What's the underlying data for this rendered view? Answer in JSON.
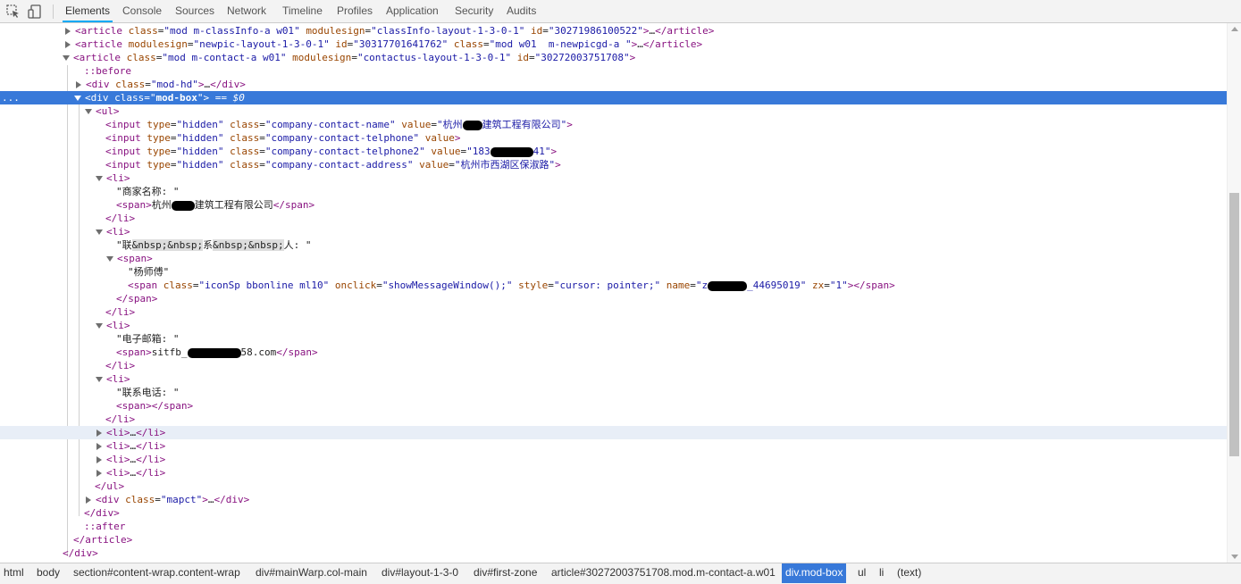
{
  "toolbar": {
    "tabs": [
      "Elements",
      "Console",
      "Sources",
      "Network",
      "Timeline",
      "Profiles",
      "Application",
      "Security",
      "Audits"
    ],
    "active_tab": "Elements",
    "icons": [
      "inspect-icon",
      "device-mode-icon"
    ]
  },
  "tree": {
    "lines": [
      {
        "a1": "article",
        "a1c": "mod m-classInfo-a w01",
        "a1m": "classInfo-layout-1-3-0-1",
        "a1id": "30271986100522"
      },
      {
        "a2": "article",
        "a2m": "newpic-layout-1-3-0-1",
        "a2id": "30317701641762",
        "a2c": "mod w01  m-newpicgd-a "
      },
      {
        "a3": "article",
        "a3c": "mod m-contact-a w01",
        "a3m": "contactus-layout-1-3-0-1",
        "a3id": "30272003751708"
      },
      {
        "before": "::before"
      },
      {
        "d1": "div",
        "d1c": "mod-hd"
      },
      {
        "d2": "div",
        "d2c": "mod-box",
        "marker": "== $0",
        "gutter": "..."
      },
      {
        "ul": "ul"
      },
      {
        "i1n": "company-contact-name",
        "i1v_pre": "杭州",
        "i1v_post": "建筑工程有限公司"
      },
      {
        "i2n": "company-contact-telphone"
      },
      {
        "i3n": "company-contact-telphone2",
        "i3v_pre": "183",
        "i3v_post": "41"
      },
      {
        "i4n": "company-contact-address",
        "i4v": "杭州市西湖区保淑路"
      },
      {
        "li": "li"
      },
      {
        "t1": "\"商家名称: \""
      },
      {
        "s1_pre": "杭州",
        "s1_post": "建筑工程有限公司"
      },
      {
        "li_close": "li"
      },
      {
        "li": "li"
      },
      {
        "t2_a": "\"联",
        "t2_nb1": "&nbsp;",
        "t2_nb2": "&nbsp;",
        "t2_b": "系",
        "t2_nb3": "&nbsp;",
        "t2_nb4": "&nbsp;",
        "t2_c": "人: \""
      },
      {
        "span": "span"
      },
      {
        "t3": "\"杨师傅\""
      },
      {
        "s2c": "iconSp bbonline ml10",
        "s2on": "showMessageWindow();",
        "s2st": "cursor: pointer;",
        "s2nm_pre": "z",
        "s2nm_post": "_44695019",
        "s2zx": "1"
      },
      {
        "span_close": "span"
      },
      {
        "li_close": "li"
      },
      {
        "li": "li"
      },
      {
        "t4": "\"电子邮箱: \""
      },
      {
        "s3_pre": "sitfb_",
        "s3_post": "58.com"
      },
      {
        "li_close": "li"
      },
      {
        "li": "li"
      },
      {
        "t5": "\"联系电话: \""
      },
      {
        "span_empty": "span"
      },
      {
        "li_close": "li"
      },
      {
        "li_collapsed": "li"
      },
      {
        "li_collapsed": "li"
      },
      {
        "li_collapsed": "li"
      },
      {
        "li_collapsed": "li"
      },
      {
        "ul_close": "ul"
      },
      {
        "d3": "div",
        "d3c": "mapct"
      },
      {
        "div_close": "div"
      },
      {
        "after": "::after"
      },
      {
        "article_close": "article"
      },
      {
        "div_close2": "div"
      }
    ]
  },
  "attrs": {
    "class": "class",
    "modulesign": "modulesign",
    "id": "id",
    "type": "type",
    "hidden": "hidden",
    "value": "value",
    "onclick": "onclick",
    "style": "style",
    "name": "name",
    "zx": "zx"
  },
  "breadcrumbs": [
    "html",
    "body",
    "section#content-wrap.content-wrap",
    "div#mainWarp.col-main",
    "div#layout-1-3-0",
    "div#first-zone",
    "article#30272003751708.mod.m-contact-a.w01",
    "div.mod-box",
    "ul",
    "li",
    "(text)"
  ],
  "active_crumb": "div.mod-box"
}
